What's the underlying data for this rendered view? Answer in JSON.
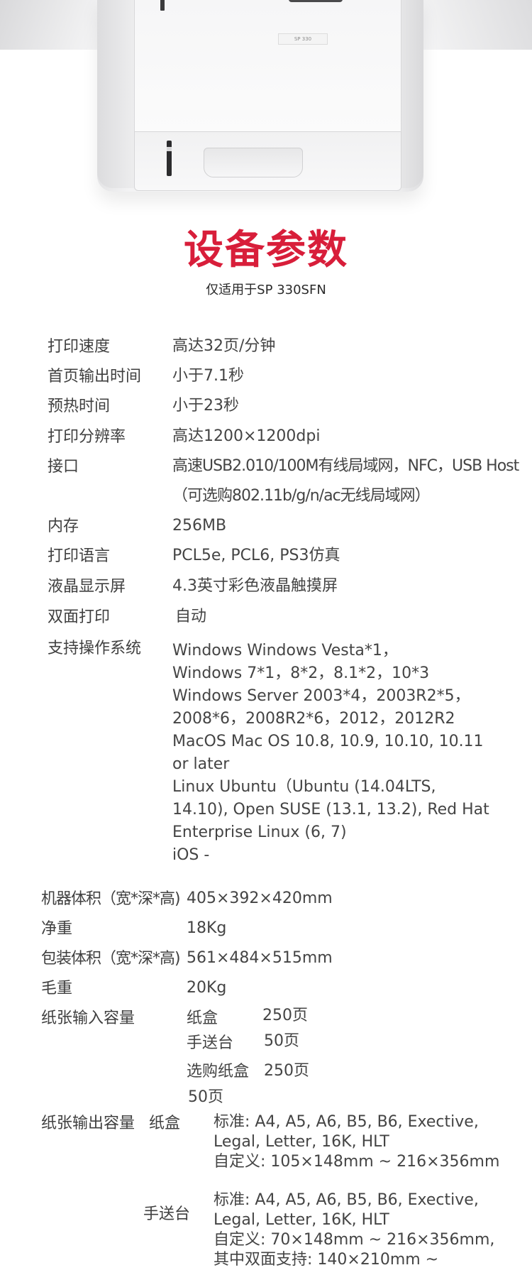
{
  "hero": {
    "model_badge": "SP 330",
    "product_image": "printer-icon"
  },
  "title": "设备参数",
  "subtitle": "仅适用于SP 330SFN",
  "specs": [
    {
      "label": "打印速度",
      "value": "高达32页/分钟"
    },
    {
      "label": "首页输出时间",
      "value": "小于7.1秒"
    },
    {
      "label": "预热时间",
      "value": "小于23秒"
    },
    {
      "label": "打印分辨率",
      "value": "高达1200×1200dpi"
    },
    {
      "label": "接口",
      "value": "高速USB2.010/100M有线局域网，NFC，USB Host",
      "value2": "（可选购802.11b/g/n/ac无线局域网）"
    },
    {
      "label": "内存",
      "value": "256MB"
    },
    {
      "label": "打印语言",
      "value": "PCL5e, PCL6, PS3仿真"
    },
    {
      "label": "液晶显示屏",
      "value": "4.3英寸彩色液晶触摸屏"
    },
    {
      "label": "双面打印",
      "value": "自动"
    }
  ],
  "os": {
    "label": "支持操作系统",
    "lines": [
      "Windows Windows Vesta*1，",
      "Windows 7*1，8*2，8.1*2，10*3",
      "Windows Server 2003*4，2003R2*5，",
      "2008*6，2008R2*6，2012，2012R2",
      "MacOS    Mac OS 10.8, 10.9, 10.10, 10.11",
      "or later",
      "Linux  Ubuntu（Ubuntu (14.04LTS,",
      "14.10), Open SUSE (13.1, 13.2), Red Hat",
      "Enterprise Linux (6, 7)",
      "iOS -"
    ]
  },
  "physical": [
    {
      "label": "机器体积（宽*深*高)",
      "value": "405×392×420mm"
    },
    {
      "label": "净重",
      "value": "18Kg"
    },
    {
      "label": "包装体积（宽*深*高)",
      "value": "561×484×515mm"
    },
    {
      "label": "毛重",
      "value": "20Kg"
    }
  ],
  "input": {
    "label": "纸张输入容量",
    "rows": [
      {
        "name": "纸盒",
        "value": "250页"
      },
      {
        "name": "手送台",
        "value": "50页"
      },
      {
        "name": "选购纸盒",
        "value": "250页"
      }
    ],
    "extra": "50页"
  },
  "output": {
    "label": "纸张输出容量",
    "tray_label": "纸盒",
    "tray_lines": [
      "标准: A4, A5, A6, B5, B6, Exective,",
      "Legal, Letter, 16K, HLT",
      "自定义: 105×148mm ~ 216×356mm"
    ],
    "bypass_label": "手送台",
    "bypass_lines": [
      "标准: A4, A5, A6, B5, B6, Exective,",
      "Legal, Letter, 16K, HLT",
      "自定义: 70×148mm ~ 216×356mm,",
      "其中双面支持: 140×210mm ~"
    ]
  }
}
